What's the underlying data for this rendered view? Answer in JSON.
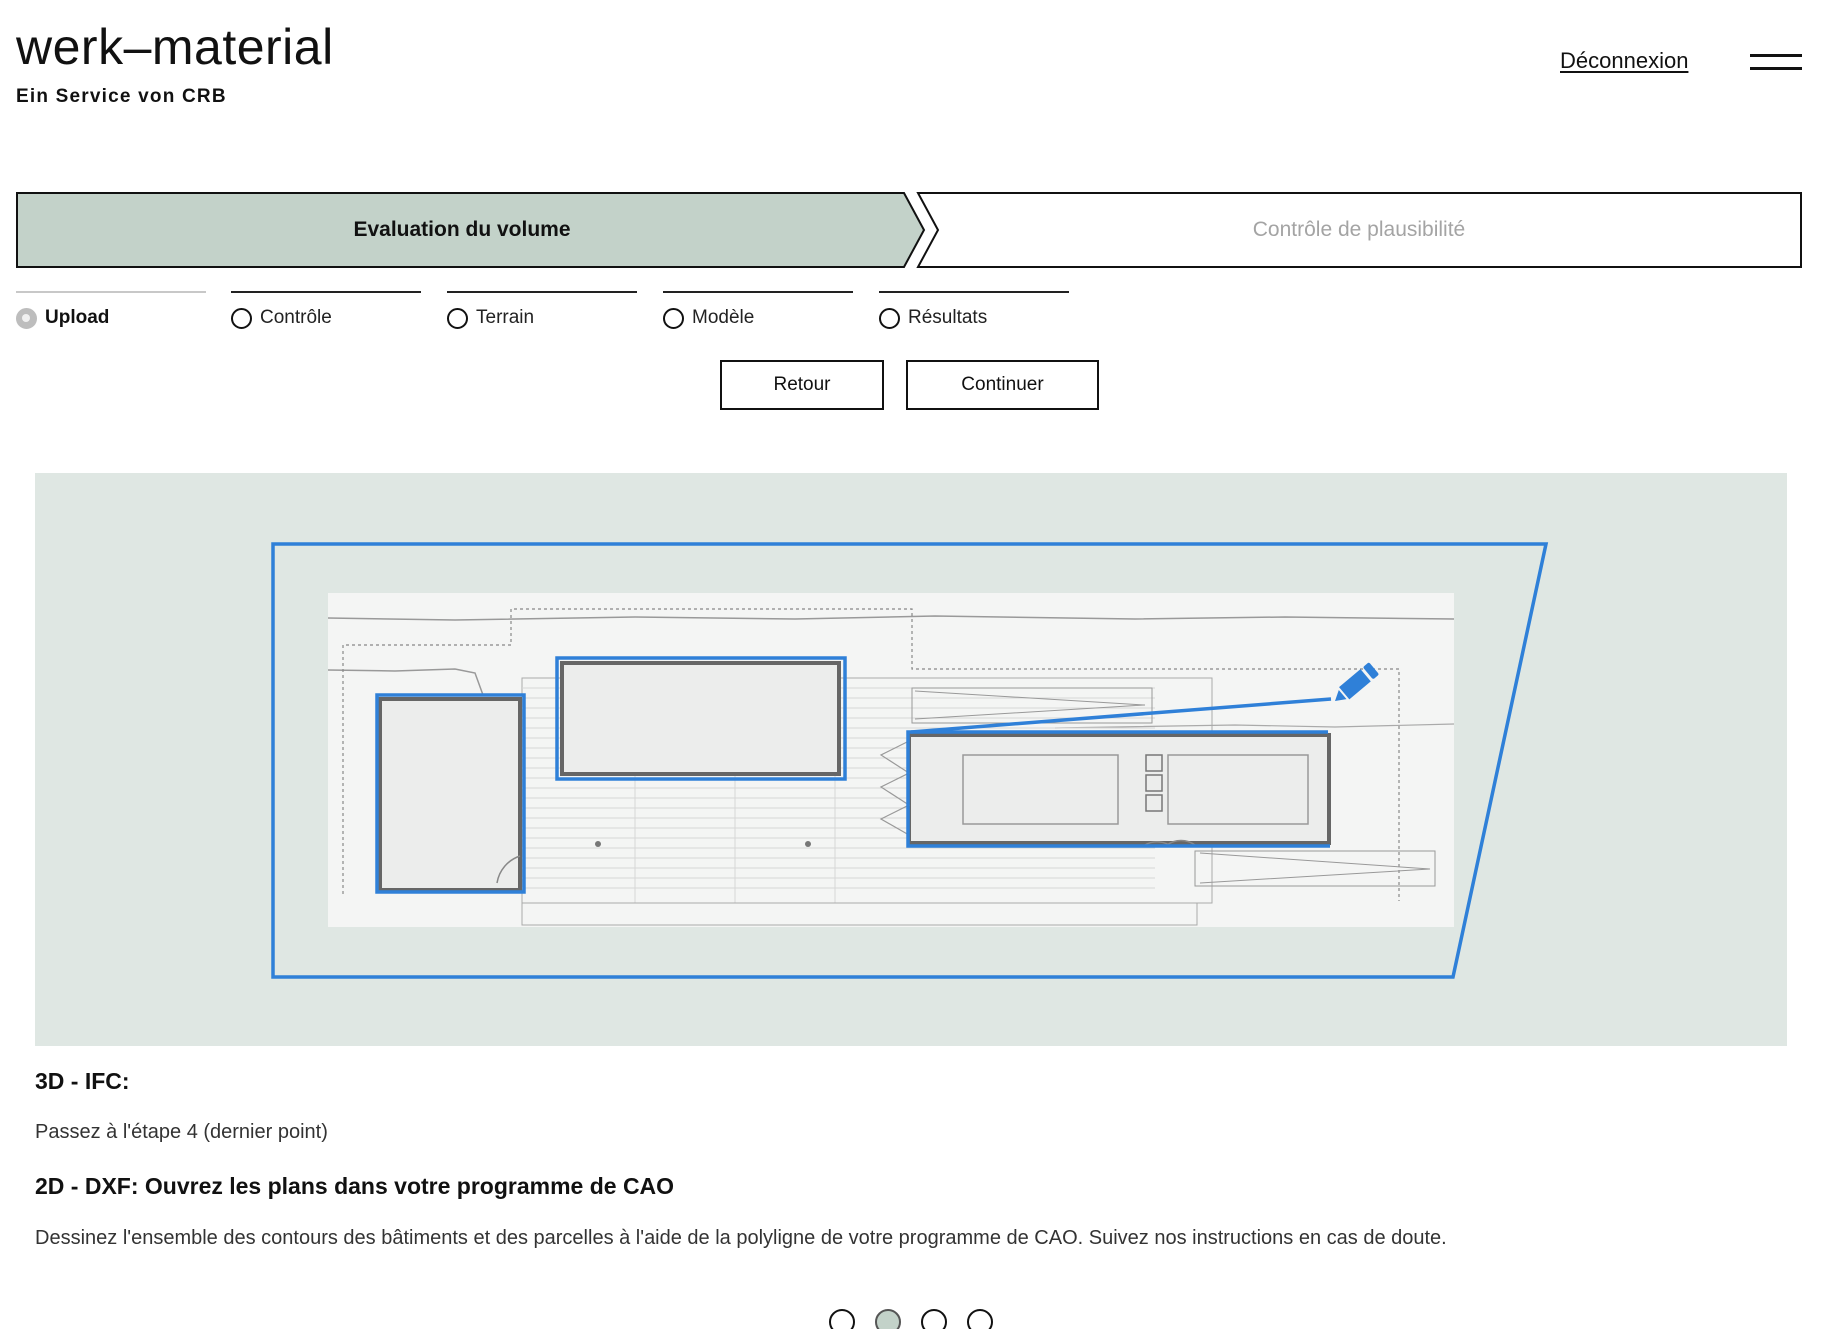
{
  "header": {
    "logo_title": "werk–material",
    "logo_subtitle": "Ein Service von CRB",
    "logout_label": "Déconnexion"
  },
  "stages": [
    {
      "label": "Evaluation du volume",
      "active": true
    },
    {
      "label": "Contrôle de plausibilité",
      "active": false
    }
  ],
  "substeps": [
    {
      "label": "Upload",
      "active": true
    },
    {
      "label": "Contrôle",
      "active": false
    },
    {
      "label": "Terrain",
      "active": false
    },
    {
      "label": "Modèle",
      "active": false
    },
    {
      "label": "Résultats",
      "active": false
    }
  ],
  "actions": {
    "back_label": "Retour",
    "next_label": "Continuer"
  },
  "content": {
    "heading_3d": "3D - IFC:",
    "text_3d": "Passez à l'étape 4 (dernier point)",
    "heading_2d": "2D - DXF: Ouvrez les plans dans votre programme de CAO",
    "text_2d": "Dessinez l'ensemble des contours des bâtiments et des parcelles à l'aide de la polyligne de votre programme de CAO. Suivez nos instructions en cas de doute."
  },
  "pager": {
    "total": 4,
    "current": 2
  },
  "colors": {
    "stage_active_fill": "#c3d2c9",
    "illustration_bg": "#dfe7e3",
    "outline_blue": "#2f80d8",
    "stage_inactive_text": "#a4a4a4"
  },
  "icons": {
    "edit": "pencil-icon",
    "menu": "hamburger-menu-icon"
  }
}
